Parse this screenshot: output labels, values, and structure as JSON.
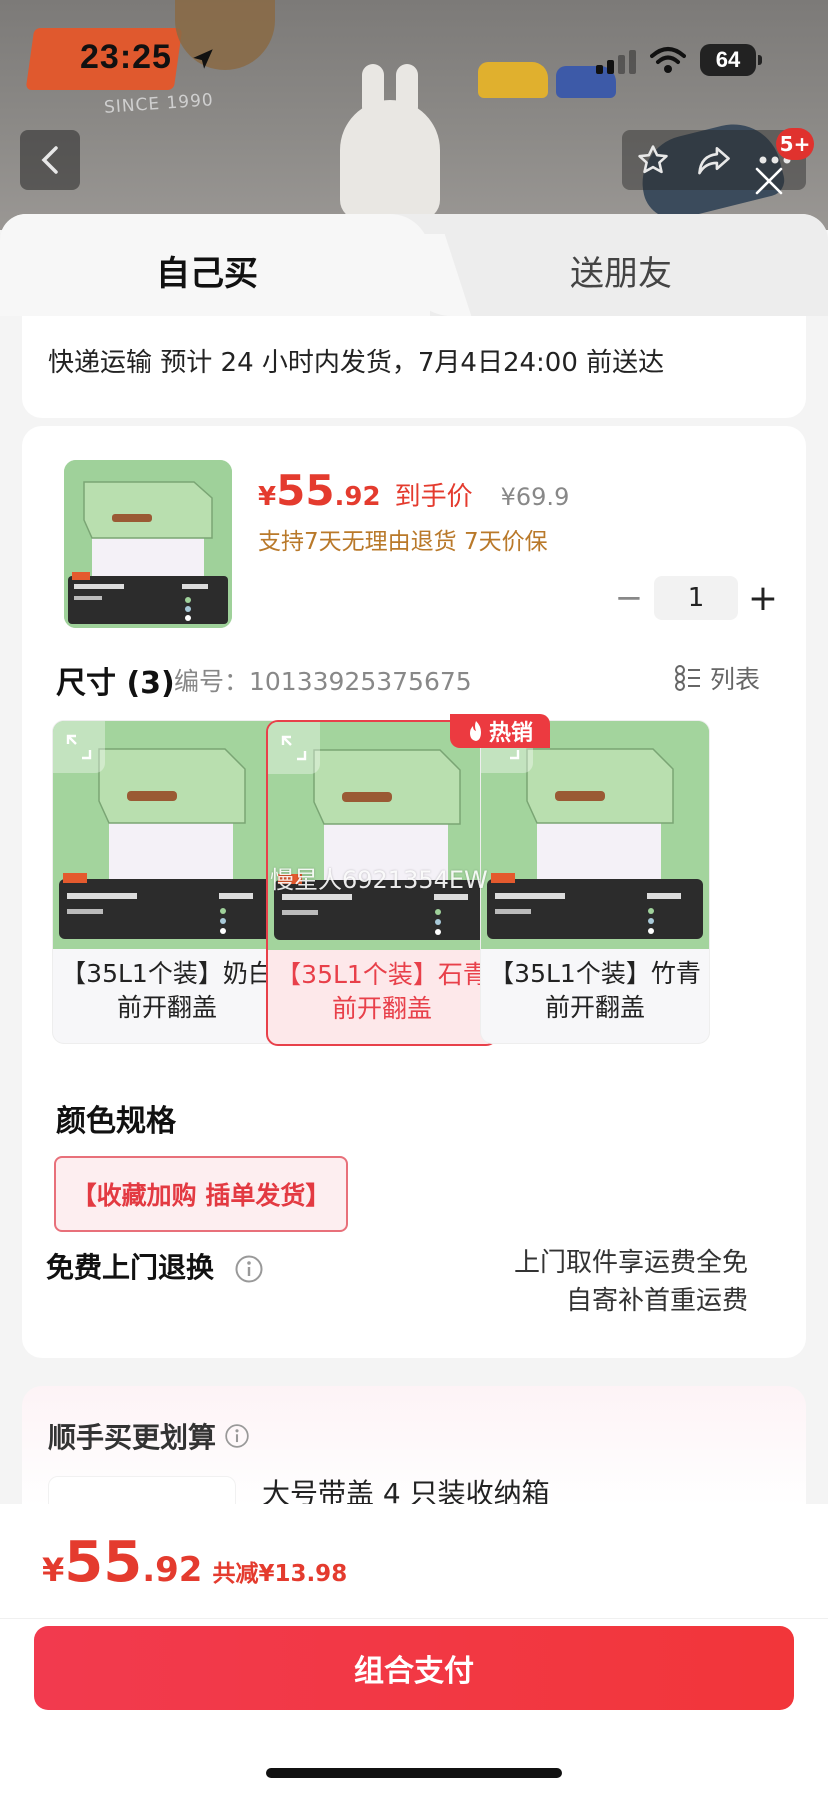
{
  "status_bar": {
    "time": "23:25",
    "battery": "64"
  },
  "background": {
    "brand_since": "SINCE 1990"
  },
  "nav": {
    "message_badge": "5+"
  },
  "tabs": [
    {
      "label": "自己买"
    },
    {
      "label": "送朋友"
    }
  ],
  "shipping": {
    "text": "快递运输 预计 24 小时内发货，7月4日24:00 前送达"
  },
  "product": {
    "price_symbol": "¥",
    "price_int": "55",
    "price_dec": ".92",
    "price_tag": "到手价",
    "original_price": "¥69.9",
    "promise": "支持7天无理由退货  7天价保",
    "quantity": "1",
    "minus": "−",
    "plus": "+"
  },
  "size": {
    "title": "尺寸 (3)",
    "sku_no": "编号：10133925375675",
    "list_label": "列表",
    "variants": [
      {
        "label": "【35L1个装】奶白 前开翻盖"
      },
      {
        "label": "【35L1个装】石青 前开翻盖"
      },
      {
        "label": "【35L1个装】竹青 前开翻盖"
      }
    ],
    "hot_label": "热销",
    "watermark": "慢星人6921354EW"
  },
  "color": {
    "title": "颜色规格",
    "option": "【收藏加购 插单发货】"
  },
  "return": {
    "title": "免费上门退换",
    "line1": "上门取件享运费全免",
    "line2": "自寄补首重运费"
  },
  "addon": {
    "title": "顺手买更划算",
    "item_name": "大号带盖 4 只装收纳箱"
  },
  "bottom": {
    "total_symbol": "¥",
    "total_int": "55",
    "total_dec": ".92",
    "total_save": "共减¥13.98",
    "pay_label": "组合支付"
  },
  "colors": {
    "accent": "#e43b2e",
    "promise": "#b9792a",
    "product_green": "#a3d49d"
  }
}
